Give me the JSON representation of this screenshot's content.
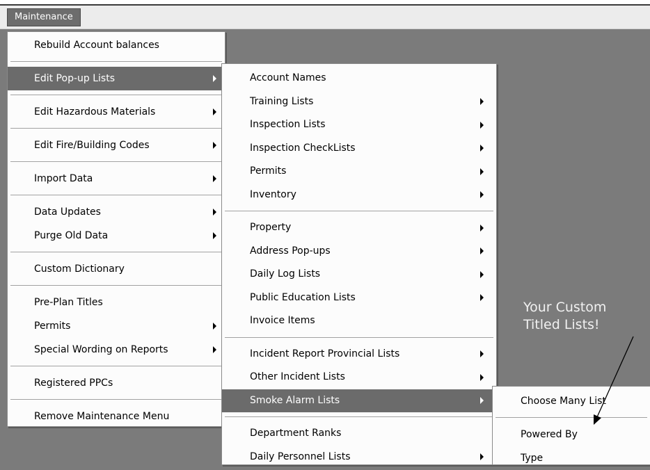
{
  "menubar": {
    "label": "Maintenance"
  },
  "main_menu": {
    "rebuild": "Rebuild Account balances",
    "edit_popup": "Edit Pop-up Lists",
    "edit_hazmat": "Edit Hazardous Materials",
    "edit_codes": "Edit Fire/Building Codes",
    "import": "Import Data",
    "data_updates": "Data Updates",
    "purge": "Purge Old Data",
    "dictionary": "Custom Dictionary",
    "preplan": "Pre-Plan Titles",
    "permits": "Permits",
    "special_wording": "Special Wording on Reports",
    "registered_ppcs": "Registered PPCs",
    "remove_menu": "Remove Maintenance Menu"
  },
  "sub_menu": {
    "account_names": "Account Names",
    "training": "Training Lists",
    "inspection": "Inspection Lists",
    "inspection_checklists": "Inspection CheckLists",
    "permits": "Permits",
    "inventory": "Inventory",
    "property": "Property",
    "address": "Address Pop-ups",
    "daily_log": "Daily Log Lists",
    "public_ed": "Public Education Lists",
    "invoice": "Invoice Items",
    "incident_provincial": "Incident Report Provincial Lists",
    "other_incident": "Other Incident Lists",
    "smoke_alarm": "Smoke Alarm Lists",
    "dept_ranks": "Department Ranks",
    "daily_personnel": "Daily Personnel Lists"
  },
  "sub3_menu": {
    "choose_many": "Choose Many List",
    "powered_by": "Powered By",
    "type": "Type"
  },
  "annotation": {
    "line1": "Your Custom",
    "line2": "Titled Lists!"
  },
  "colors": {
    "background": "#7b7b7b",
    "menu": "#fcfcfc",
    "highlight": "#6b6b6b"
  }
}
